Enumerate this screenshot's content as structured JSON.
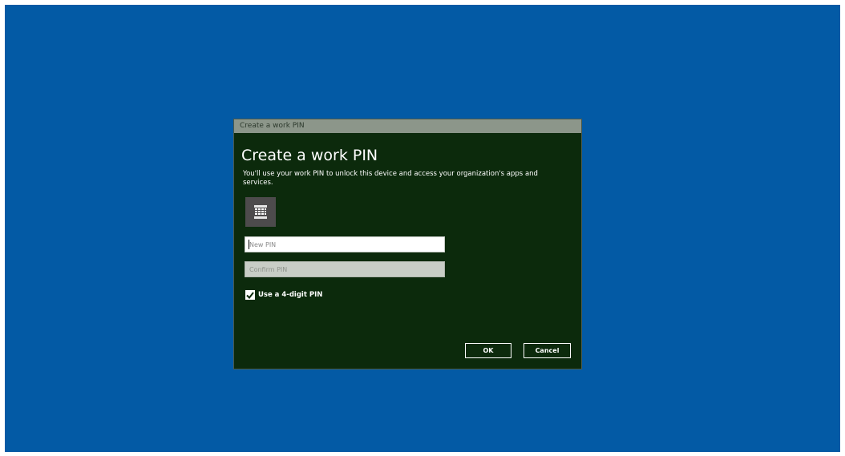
{
  "dialog": {
    "title": "Create a work PIN",
    "heading": "Create a work PIN",
    "description": "You'll use your work PIN to unlock this device and access your organization's apps and services.",
    "keypad_icon": "keypad-icon",
    "new_pin": {
      "value": "",
      "placeholder": "New PIN"
    },
    "confirm_pin": {
      "value": "",
      "placeholder": "Confirm PIN"
    },
    "use_4_digit": {
      "label": "Use a 4-digit PIN",
      "checked": true
    },
    "ok_label": "OK",
    "cancel_label": "Cancel"
  },
  "colors": {
    "desktop": "#035aa5",
    "dialog_background": "#0c2a0c",
    "titlebar": "#8c968a",
    "keypad_button": "#4d4b4c"
  }
}
